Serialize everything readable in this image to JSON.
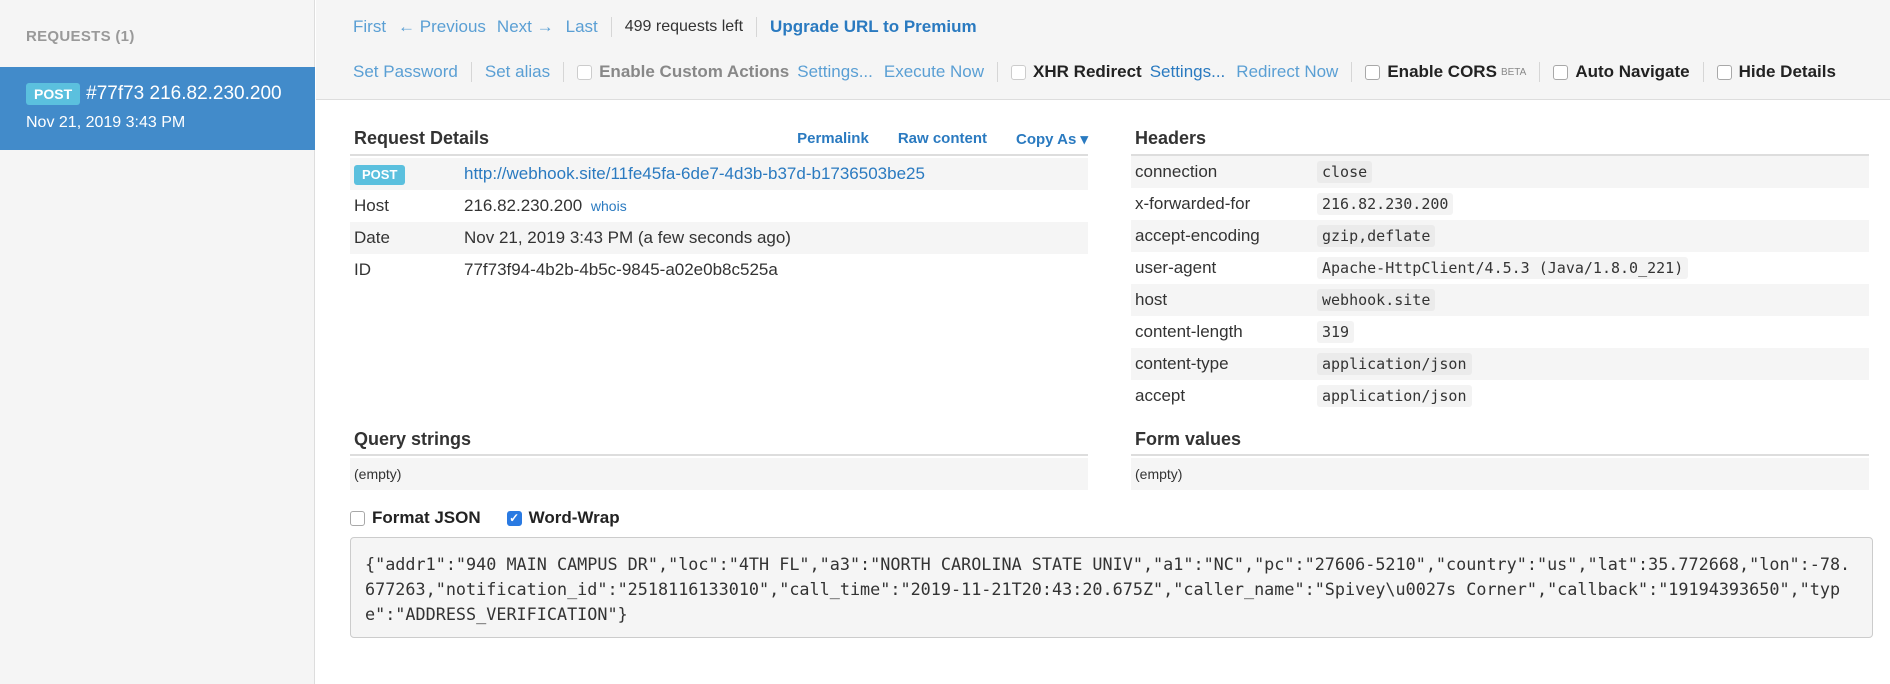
{
  "sidebar": {
    "header": "REQUESTS (1)",
    "requests": [
      {
        "method": "POST",
        "title": "#77f73 216.82.230.200",
        "date": "Nov 21, 2019 3:43 PM"
      }
    ]
  },
  "topbar": {
    "nav": {
      "first": "First",
      "previous": "← Previous",
      "next": "Next →",
      "last": "Last"
    },
    "requests_left": "499 requests left",
    "upgrade": "Upgrade URL to Premium",
    "set_password": "Set Password",
    "set_alias": "Set alias",
    "custom_actions": {
      "label": "Enable Custom Actions",
      "settings": "Settings...",
      "execute": "Execute Now"
    },
    "xhr": {
      "label": "XHR Redirect",
      "settings": "Settings...",
      "redirect": "Redirect Now"
    },
    "cors": {
      "label": "Enable CORS",
      "beta": "BETA"
    },
    "auto_navigate": "Auto Navigate",
    "hide_details": "Hide Details"
  },
  "request_details": {
    "title": "Request Details",
    "links": {
      "permalink": "Permalink",
      "raw": "Raw content",
      "copy_as": "Copy As ▾"
    },
    "method": "POST",
    "url": "http://webhook.site/11fe45fa-6de7-4d3b-b37d-b1736503be25",
    "host_label": "Host",
    "host": "216.82.230.200",
    "whois": "whois",
    "date_label": "Date",
    "date": "Nov 21, 2019 3:43 PM (a few seconds ago)",
    "id_label": "ID",
    "id": "77f73f94-4b2b-4b5c-9845-a02e0b8c525a"
  },
  "headers": {
    "title": "Headers",
    "rows": [
      {
        "key": "connection",
        "value": "close"
      },
      {
        "key": "x-forwarded-for",
        "value": "216.82.230.200"
      },
      {
        "key": "accept-encoding",
        "value": "gzip,deflate"
      },
      {
        "key": "user-agent",
        "value": "Apache-HttpClient/4.5.3 (Java/1.8.0_221)"
      },
      {
        "key": "host",
        "value": "webhook.site"
      },
      {
        "key": "content-length",
        "value": "319"
      },
      {
        "key": "content-type",
        "value": "application/json"
      },
      {
        "key": "accept",
        "value": "application/json"
      }
    ]
  },
  "query_strings": {
    "title": "Query strings",
    "value": "(empty)"
  },
  "form_values": {
    "title": "Form values",
    "value": "(empty)"
  },
  "format": {
    "format_json": "Format JSON",
    "word_wrap": "Word-Wrap",
    "format_json_checked": false,
    "word_wrap_checked": true
  },
  "body": "{\"addr1\":\"940 MAIN CAMPUS DR\",\"loc\":\"4TH FL\",\"a3\":\"NORTH CAROLINA STATE UNIV\",\"a1\":\"NC\",\"pc\":\"27606-5210\",\"country\":\"us\",\"lat\":35.772668,\"lon\":-78.677263,\"notification_id\":\"2518116133010\",\"call_time\":\"2019-11-21T20:43:20.675Z\",\"caller_name\":\"Spivey\\u0027s Corner\",\"callback\":\"19194393650\",\"type\":\"ADDRESS_VERIFICATION\"}"
}
